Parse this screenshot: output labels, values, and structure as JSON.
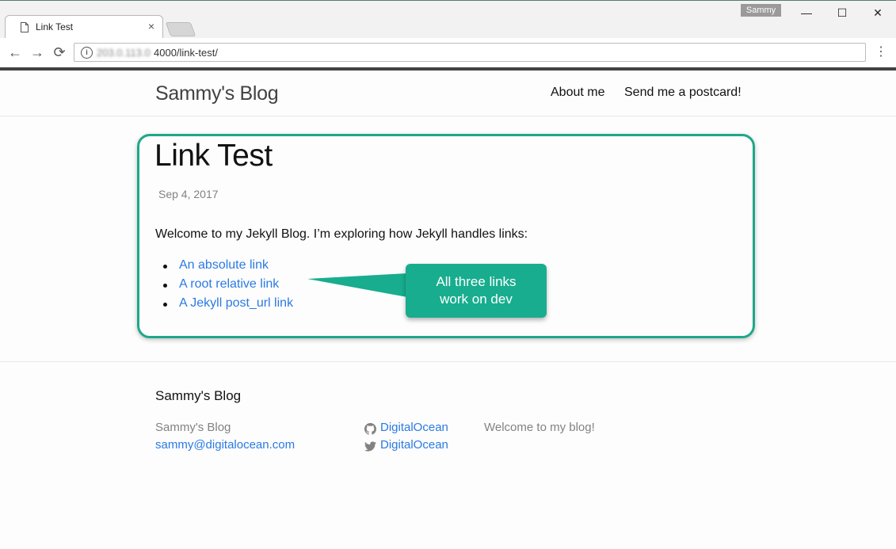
{
  "browser": {
    "tab_title": "Link Test",
    "tab_close": "×",
    "profile_name": "Sammy",
    "window_controls": {
      "minimize": "—",
      "maximize": "☐",
      "close": "✕"
    },
    "url_host": "203.0.113.0",
    "url_path": "4000/link-test/",
    "nav": {
      "back": "←",
      "forward": "→",
      "reload": "⟳",
      "menu": "⋮"
    }
  },
  "site": {
    "title": "Sammy's Blog",
    "nav": [
      {
        "label": "About me"
      },
      {
        "label": "Send me a postcard!"
      }
    ]
  },
  "post": {
    "title": "Link Test",
    "date": "Sep 4, 2017",
    "intro": "Welcome to my Jekyll Blog. I’m exploring how Jekyll handles links:",
    "links": [
      {
        "label": "An absolute link"
      },
      {
        "label": "A root relative link"
      },
      {
        "label": "A Jekyll post_url link"
      }
    ]
  },
  "annotation": {
    "line1": "All three links",
    "line2": "work on dev",
    "color": "#18ad8e"
  },
  "footer": {
    "heading": "Sammy's Blog",
    "name": "Sammy's Blog",
    "email": "sammy@digitalocean.com",
    "github_label": "DigitalOcean",
    "twitter_label": "DigitalOcean",
    "description": "Welcome to my blog!"
  },
  "colors": {
    "link": "#2a7ae2",
    "highlight": "#1ea88a"
  }
}
